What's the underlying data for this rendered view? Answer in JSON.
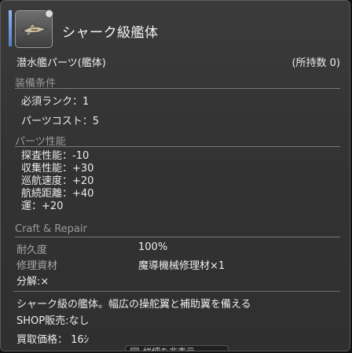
{
  "item": {
    "name": "シャーク級艦体",
    "icon": "submarine-hull-icon",
    "category": "潜水艦パーツ(艦体)",
    "owned": "(所持数 0)"
  },
  "requirements": {
    "header": "装備条件",
    "rank": "必須ランク：1",
    "cost": "パーツコスト：5"
  },
  "performance": {
    "header": "パーツ性能",
    "stats": [
      "探査性能：-10",
      "収集性能：+30",
      "巡航速度：+20",
      "航続距離：+40",
      "運：+20"
    ]
  },
  "craft": {
    "header": "Craft & Repair",
    "durability_label": "耐久度",
    "durability_value": "100%",
    "repair_label": "修理資材",
    "repair_value": "魔導機械修理材×1",
    "desynth": "分解:×"
  },
  "description": "シャーク級の艦体。幅広の操舵翼と補助翼を備える",
  "shop": "SHOP販売:なし",
  "sell_price": "買取価格： 16ｼ",
  "toggle_label": "詳細を非表示",
  "colors": {
    "accent": "#6a9cf0",
    "rule": "#777777"
  }
}
